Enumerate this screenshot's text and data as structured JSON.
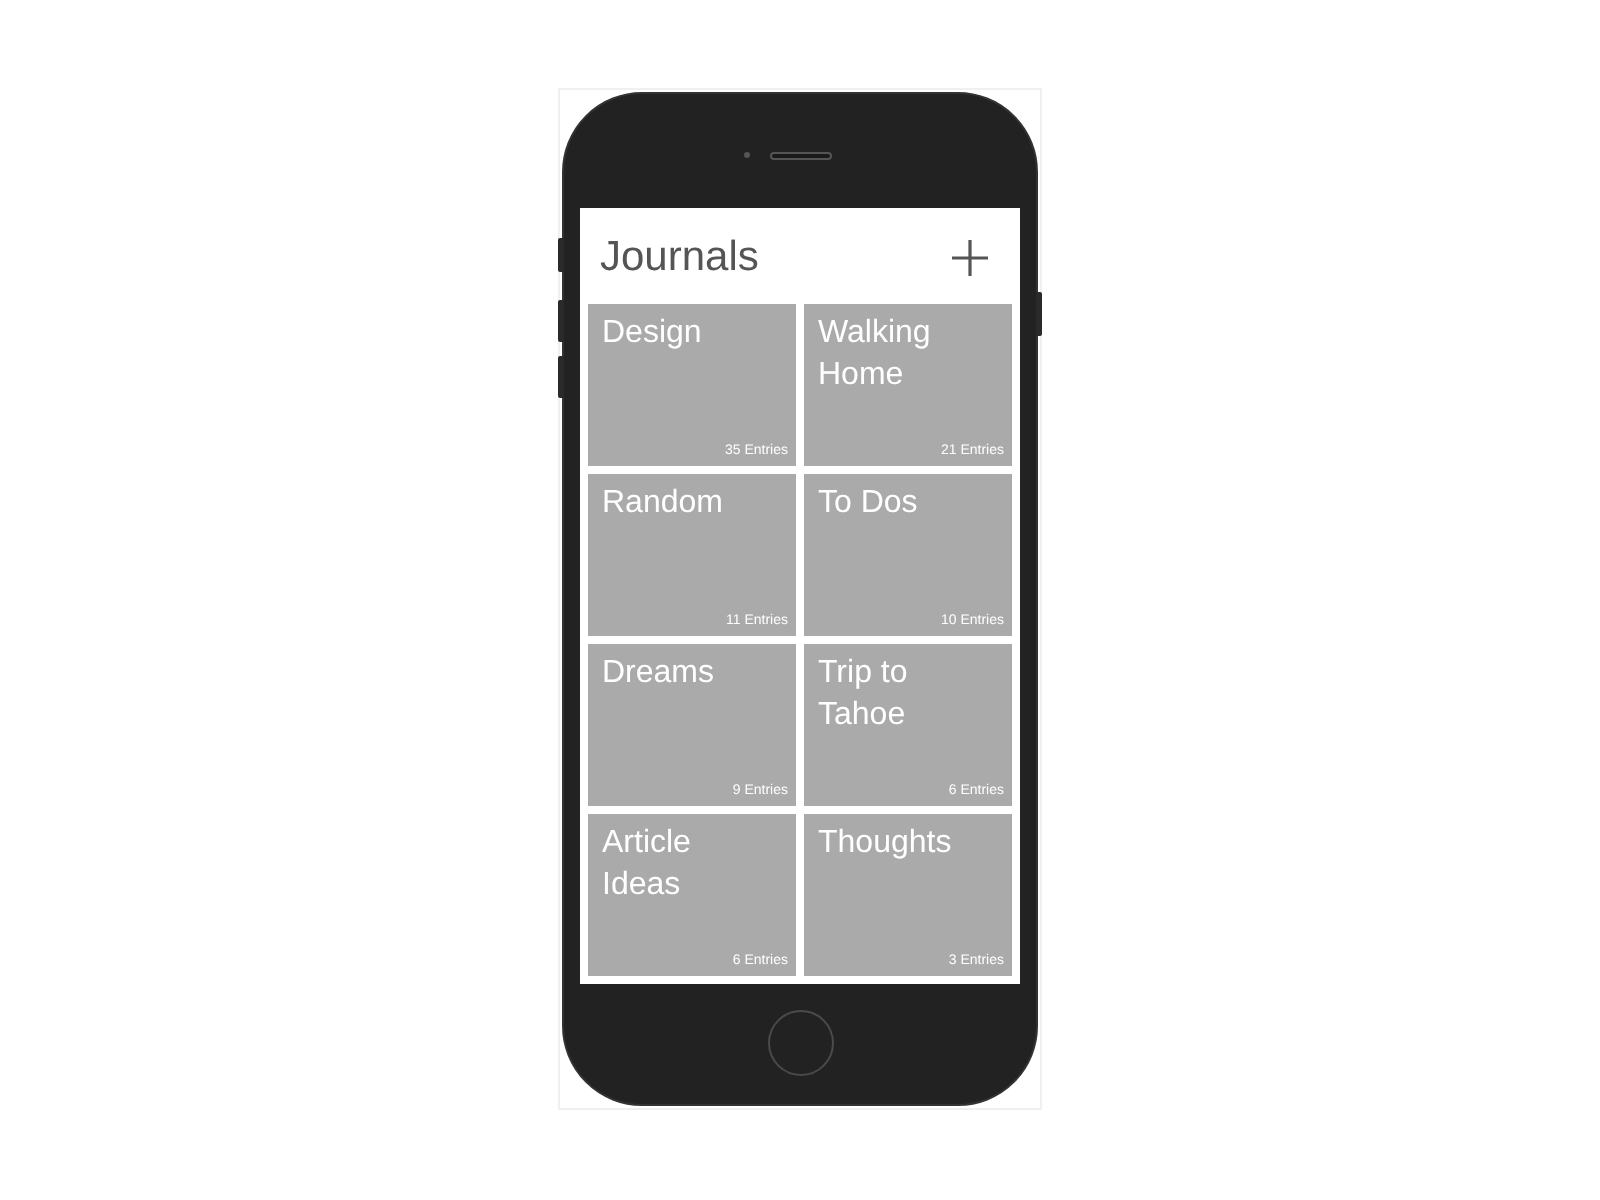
{
  "header": {
    "title": "Journals"
  },
  "journals": [
    {
      "title": "Design",
      "entries": "35 Entries"
    },
    {
      "title": "Walking Home",
      "entries": "21 Entries"
    },
    {
      "title": "Random",
      "entries": "11 Entries"
    },
    {
      "title": "To Dos",
      "entries": "10 Entries"
    },
    {
      "title": "Dreams",
      "entries": "9 Entries"
    },
    {
      "title": "Trip to Tahoe",
      "entries": "6 Entries"
    },
    {
      "title": "Article Ideas",
      "entries": "6 Entries"
    },
    {
      "title": "Thoughts",
      "entries": "3 Entries"
    }
  ]
}
